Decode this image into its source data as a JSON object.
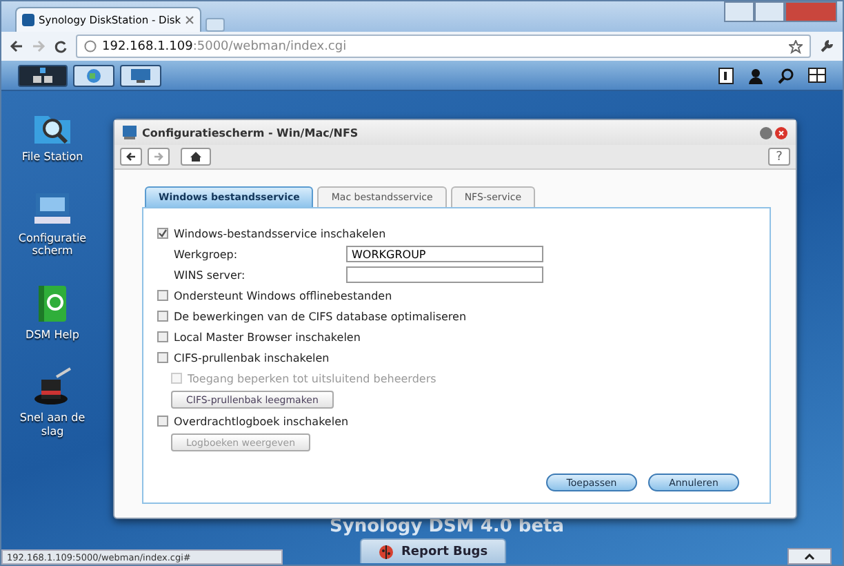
{
  "browser": {
    "tab_title": "Synology DiskStation - Disk",
    "url_host": "192.168.1.109",
    "url_rest": ":5000/webman/index.cgi",
    "status_url": "192.168.1.109:5000/webman/index.cgi#"
  },
  "desktop_icons": [
    {
      "kind": "files",
      "label": "File Station"
    },
    {
      "kind": "config",
      "label": "Configuratie scherm"
    },
    {
      "kind": "help",
      "label": "DSM Help"
    },
    {
      "kind": "wizard",
      "label": "Snel aan de slag"
    }
  ],
  "brand": "Synology DSM 4.0 beta",
  "report_bugs": "Report Bugs",
  "dialog": {
    "title": "Configuratiescherm - Win/Mac/NFS",
    "help": "?",
    "tabs": [
      {
        "label": "Windows bestandsservice",
        "selected": true
      },
      {
        "label": "Mac bestandsservice",
        "selected": false
      },
      {
        "label": "NFS-service",
        "selected": false
      }
    ],
    "items": [
      {
        "kind": "check",
        "label": "Windows-bestandsservice inschakelen",
        "checked": true,
        "disabled": false,
        "indented": false
      },
      {
        "kind": "field",
        "label": "Werkgroep:",
        "value": "WORKGROUP"
      },
      {
        "kind": "field",
        "label": "WINS server:",
        "value": ""
      },
      {
        "kind": "check",
        "label": "Ondersteunt Windows offlinebestanden",
        "checked": false,
        "disabled": false,
        "indented": false
      },
      {
        "kind": "check",
        "label": "De bewerkingen van de CIFS database optimaliseren",
        "checked": false,
        "disabled": false,
        "indented": false
      },
      {
        "kind": "check",
        "label": "Local Master Browser inschakelen",
        "checked": false,
        "disabled": false,
        "indented": false
      },
      {
        "kind": "check",
        "label": "CIFS-prullenbak inschakelen",
        "checked": false,
        "disabled": false,
        "indented": false
      },
      {
        "kind": "check",
        "label": "Toegang beperken tot uitsluitend beheerders",
        "checked": false,
        "disabled": true,
        "indented": true
      },
      {
        "kind": "button",
        "label": "CIFS-prullenbak leegmaken",
        "disabled": false
      },
      {
        "kind": "check",
        "label": "Overdrachtlogboek inschakelen",
        "checked": false,
        "disabled": false,
        "indented": false
      },
      {
        "kind": "button",
        "label": "Logboeken weergeven",
        "disabled": true
      }
    ],
    "buttons": [
      "Toepassen",
      "Annuleren"
    ]
  }
}
